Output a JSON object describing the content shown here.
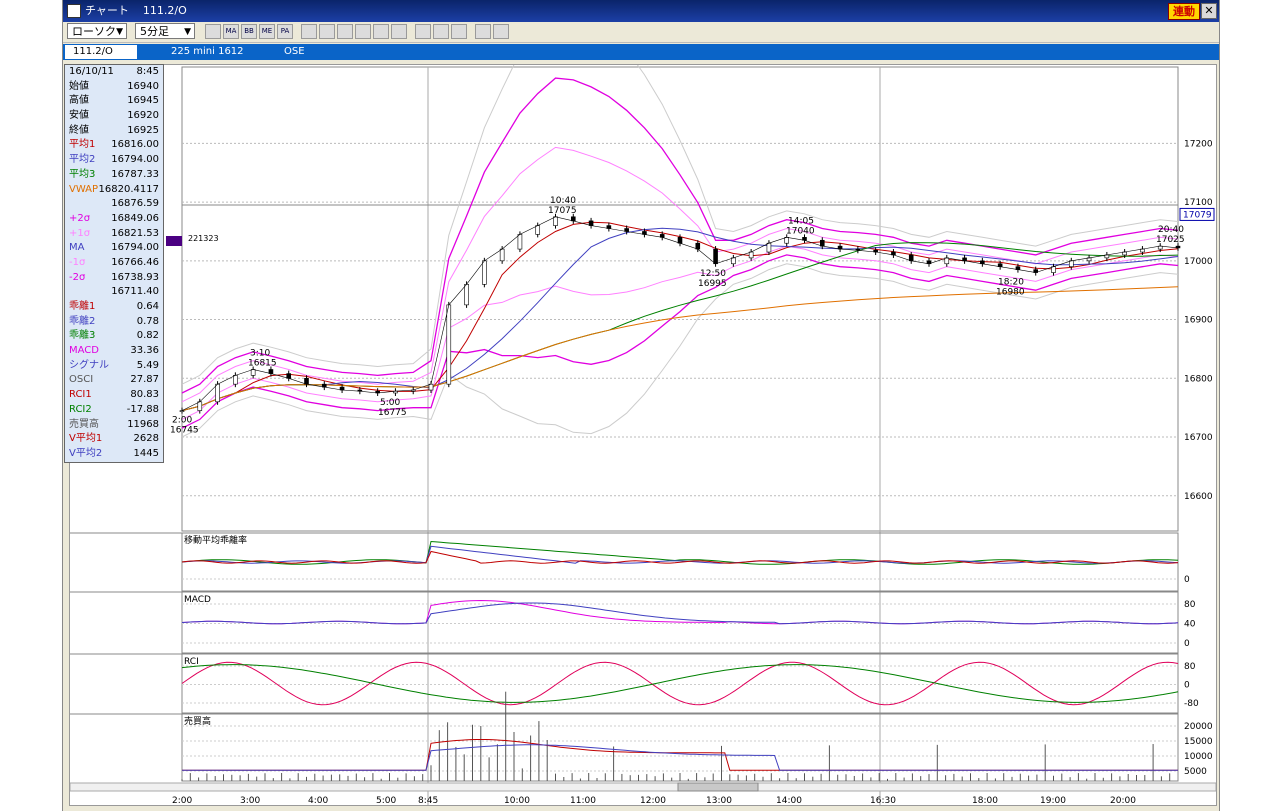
{
  "window": {
    "title": "チャート",
    "symbol": "111.2/O",
    "link_button": "連動",
    "close_glyph": "✕"
  },
  "toolbar": {
    "chart_type": "ローソク",
    "period": "5分足",
    "buttons": [
      {
        "label": "MA"
      },
      {
        "label": "BB"
      },
      {
        "label": "ME"
      },
      {
        "label": "PA"
      }
    ]
  },
  "infobar": {
    "symbol_field": "111.2/O",
    "description": "225 mini 1612",
    "exchange": "OSE"
  },
  "data_panel": [
    {
      "label": "16/10/11",
      "value": "8:45",
      "color": "#000000"
    },
    {
      "label": "始値",
      "value": "16940",
      "color": "#000000"
    },
    {
      "label": "高値",
      "value": "16945",
      "color": "#000000"
    },
    {
      "label": "安値",
      "value": "16920",
      "color": "#000000"
    },
    {
      "label": "終値",
      "value": "16925",
      "color": "#000000"
    },
    {
      "label": "平均1",
      "value": "16816.00",
      "color": "#c00000"
    },
    {
      "label": "平均2",
      "value": "16794.00",
      "color": "#4040c0"
    },
    {
      "label": "平均3",
      "value": "16787.33",
      "color": "#008000"
    },
    {
      "label": "VWAP",
      "value": "16820.4117",
      "color": "#e07000"
    },
    {
      "label": "",
      "value": "16876.59",
      "color": "#000000"
    },
    {
      "label": "+2σ",
      "value": "16849.06",
      "color": "#e000e0"
    },
    {
      "label": "+1σ",
      "value": "16821.53",
      "color": "#ff80ff"
    },
    {
      "label": "MA",
      "value": "16794.00",
      "color": "#4040c0"
    },
    {
      "label": "-1σ",
      "value": "16766.46",
      "color": "#ff80ff"
    },
    {
      "label": "-2σ",
      "value": "16738.93",
      "color": "#e000e0"
    },
    {
      "label": "",
      "value": "16711.40",
      "color": "#000000"
    },
    {
      "label": "乖離1",
      "value": "0.64",
      "color": "#c00000"
    },
    {
      "label": "乖離2",
      "value": "0.78",
      "color": "#4040c0"
    },
    {
      "label": "乖離3",
      "value": "0.82",
      "color": "#008000"
    },
    {
      "label": "MACD",
      "value": "33.36",
      "color": "#e000e0"
    },
    {
      "label": "シグナル",
      "value": "5.49",
      "color": "#4040c0"
    },
    {
      "label": "OSCI",
      "value": "27.87",
      "color": "#555555"
    },
    {
      "label": "RCI1",
      "value": "80.83",
      "color": "#c00000"
    },
    {
      "label": "RCI2",
      "value": "-17.88",
      "color": "#008000"
    },
    {
      "label": "売買高",
      "value": "11968",
      "color": "#555555"
    },
    {
      "label": "V平均1",
      "value": "2628",
      "color": "#c00000"
    },
    {
      "label": "V平均2",
      "value": "1445",
      "color": "#4040c0"
    }
  ],
  "chart_data": {
    "type": "candlestick",
    "x_ticks": [
      "2:00",
      "3:00",
      "4:00",
      "5:00",
      "8:45",
      "10:00",
      "11:00",
      "12:00",
      "13:00",
      "14:00",
      "16:30",
      "18:00",
      "19:00",
      "20:00"
    ],
    "y_ticks": [
      16600,
      16700,
      16800,
      16900,
      17000,
      17100,
      17200
    ],
    "ylim": [
      16540,
      17330
    ],
    "current_price": "17079",
    "volume_marker": "221323",
    "price_annotations": [
      {
        "time": "2:00",
        "value": "16745"
      },
      {
        "time": "3:10",
        "value": "16815"
      },
      {
        "time": "5:00",
        "value": "16775"
      },
      {
        "time": "10:40",
        "value": "17075"
      },
      {
        "time": "12:50",
        "value": "16995"
      },
      {
        "time": "14:05",
        "value": "17040"
      },
      {
        "time": "18:20",
        "value": "16980"
      },
      {
        "time": "20:40",
        "value": "17025"
      }
    ],
    "close_series": [
      16745,
      16760,
      16790,
      16805,
      16815,
      16808,
      16800,
      16790,
      16785,
      16780,
      16778,
      16775,
      16778,
      16780,
      16790,
      16925,
      16960,
      17000,
      17020,
      17045,
      17060,
      17075,
      17068,
      17060,
      17055,
      17050,
      17045,
      17040,
      17030,
      17020,
      16995,
      17005,
      17015,
      17030,
      17040,
      17035,
      17025,
      17020,
      17018,
      17015,
      17010,
      17000,
      16995,
      17005,
      17000,
      16995,
      16990,
      16985,
      16980,
      16990,
      17000,
      17005,
      17010,
      17015,
      17020,
      17025,
      17022
    ],
    "sub_panels": [
      {
        "name": "移動平均乖離率",
        "y_ticks": [
          "0"
        ]
      },
      {
        "name": "MACD",
        "y_ticks": [
          "80",
          "40",
          "0"
        ]
      },
      {
        "name": "RCI",
        "y_ticks": [
          "80",
          "0",
          "-80"
        ]
      },
      {
        "name": "売買高",
        "y_ticks": [
          "20000",
          "15000",
          "10000",
          "5000"
        ]
      }
    ]
  }
}
